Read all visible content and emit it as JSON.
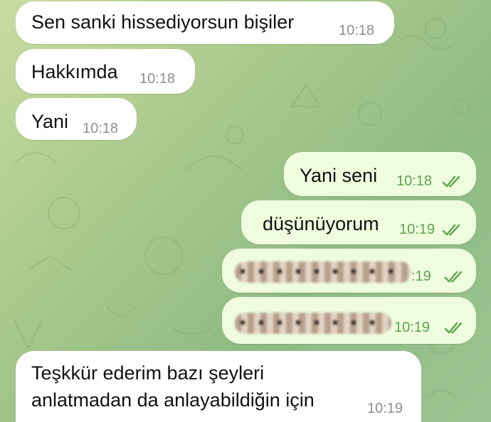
{
  "colors": {
    "incoming_bubble": "#ffffff",
    "outgoing_bubble": "#effdde",
    "outgoing_time": "#5ea34d",
    "incoming_time": "#8a8f96",
    "read_ticks": "#5ea34d"
  },
  "messages": [
    {
      "direction": "incoming",
      "text": "Sen sanki hissediyorsun bişiler",
      "time": "10:18"
    },
    {
      "direction": "incoming",
      "text": "Hakkımda",
      "time": "10:18"
    },
    {
      "direction": "incoming",
      "text": "Yani",
      "time": "10:18"
    },
    {
      "direction": "outgoing",
      "text": "Yani seni",
      "time": "10:18",
      "status_icon": "double-check-icon"
    },
    {
      "direction": "outgoing",
      "text": "düşünüyorum",
      "time": "10:19",
      "status_icon": "double-check-icon"
    },
    {
      "direction": "outgoing",
      "text": "",
      "redacted": true,
      "time": ":19",
      "status_icon": "double-check-icon"
    },
    {
      "direction": "outgoing",
      "text": "",
      "redacted": true,
      "time": "10:19",
      "status_icon": "double-check-icon"
    },
    {
      "direction": "incoming",
      "text_line1": "Teşkkür ederim bazı şeyleri",
      "text_line2": "anlatmadan da anlayabildiğin için",
      "time": "10:19"
    }
  ]
}
